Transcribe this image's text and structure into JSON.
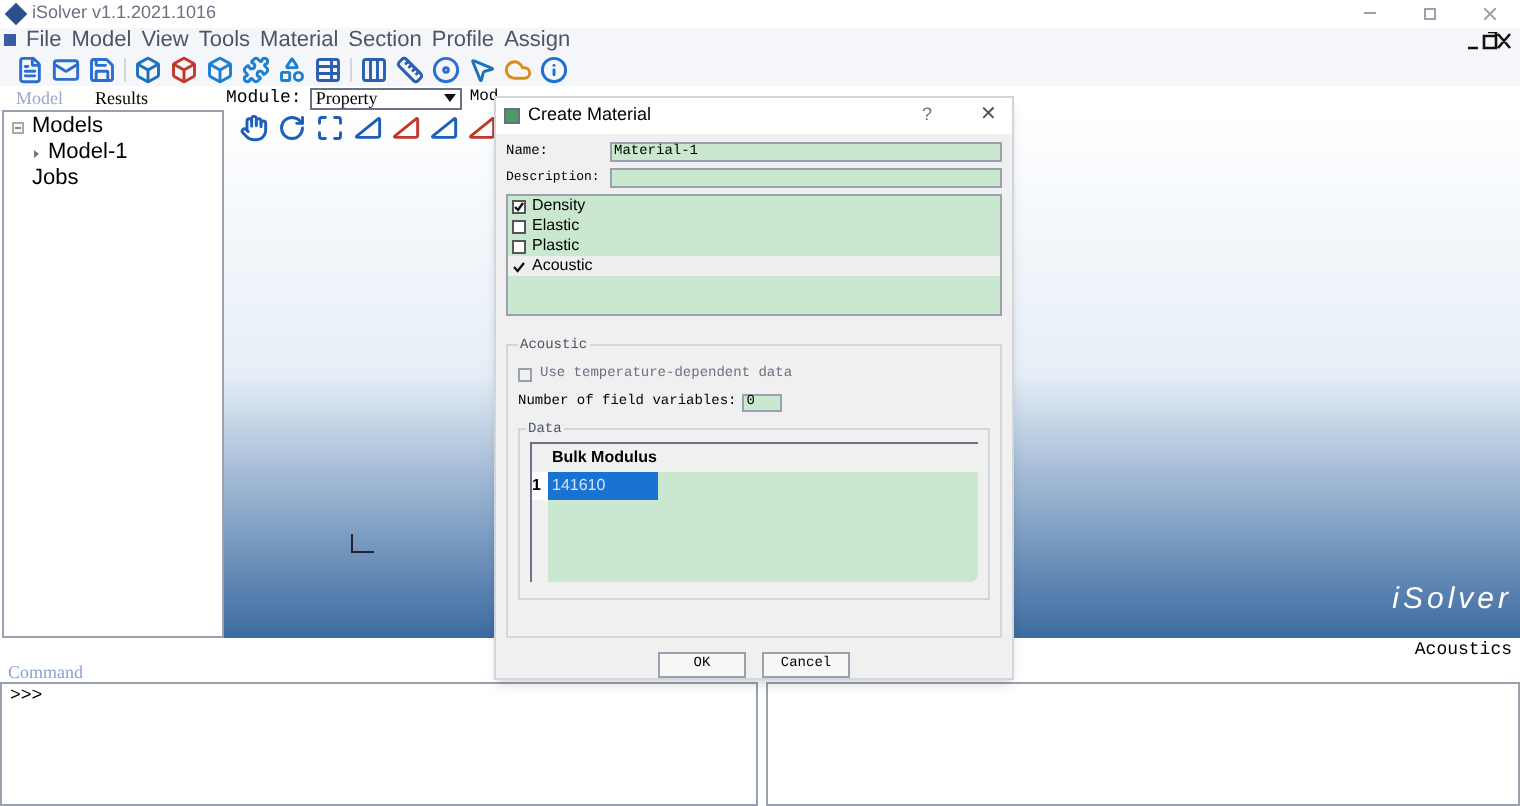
{
  "window": {
    "title": "iSolver v1.1.2021.1016"
  },
  "menu": [
    "File",
    "Model",
    "View",
    "Tools",
    "Material",
    "Section",
    "Profile",
    "Assign"
  ],
  "tabs": [
    {
      "label": "Model",
      "selected": true
    },
    {
      "label": "Results",
      "selected": false
    }
  ],
  "module": {
    "label": "Module:",
    "value": "Property",
    "next_label": "Mod"
  },
  "tree": [
    {
      "label": "Models",
      "expanded": true,
      "children": [
        {
          "label": "Model-1",
          "expanded": false
        }
      ]
    },
    {
      "label": "Jobs"
    }
  ],
  "viewport": {
    "logo": "iSolver",
    "status": "Acoustics"
  },
  "command": {
    "label": "Command",
    "prompt": ">>>"
  },
  "dialog": {
    "title": "Create Material",
    "help": "?",
    "close": "✕",
    "name_label": "Name:",
    "name_value": "Material-1",
    "description_label": "Description:",
    "behaviors": [
      {
        "label": "Density",
        "kind": "check",
        "checked": true,
        "selected": false
      },
      {
        "label": "Elastic",
        "kind": "check",
        "checked": false,
        "selected": false
      },
      {
        "label": "Plastic",
        "kind": "check",
        "checked": false,
        "selected": false
      },
      {
        "label": "Acoustic",
        "kind": "tick",
        "checked": true,
        "selected": true
      }
    ],
    "group_title": "Acoustic",
    "temp_dependent": {
      "label": "Use temperature-dependent data",
      "checked": false,
      "disabled": true
    },
    "field_vars": {
      "label": "Number of field variables:",
      "value": "0"
    },
    "data_title": "Data",
    "column": "Bulk Modulus",
    "rows": [
      {
        "index": "1",
        "value": "141610",
        "selected": true
      }
    ],
    "buttons": [
      "OK",
      "Cancel"
    ]
  }
}
